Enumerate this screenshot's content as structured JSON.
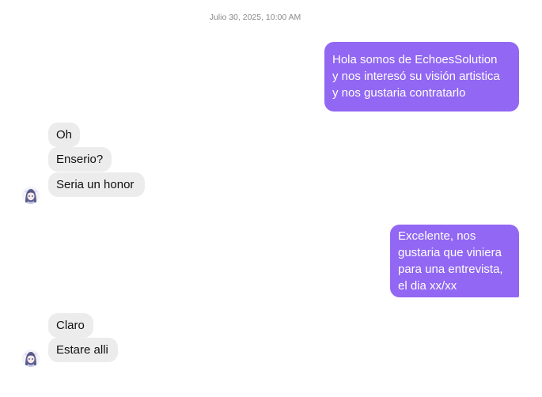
{
  "conversation": {
    "timestamp": "Julio 30, 2025, 10:00 AM",
    "outgoing": [
      {
        "text": "Hola somos de EchoesSolution\ny nos interesó su visión artistica\ny nos gustaria contratarlo"
      },
      {
        "text": "Excelente, nos\ngustaria que viniera\npara una entrevista,\nel dia xx/xx"
      }
    ],
    "incoming_group_1": [
      {
        "text": "Oh"
      },
      {
        "text": "Enserio?"
      },
      {
        "text": "Seria un honor"
      }
    ],
    "incoming_group_2": [
      {
        "text": "Claro"
      },
      {
        "text": "Estare alli"
      }
    ]
  },
  "colors": {
    "outgoing_bubble": "#9167f3",
    "incoming_bubble": "#ececec",
    "timestamp_text": "#8a8a8a"
  },
  "icons": {
    "contact_avatar": "anime-character-avatar"
  }
}
